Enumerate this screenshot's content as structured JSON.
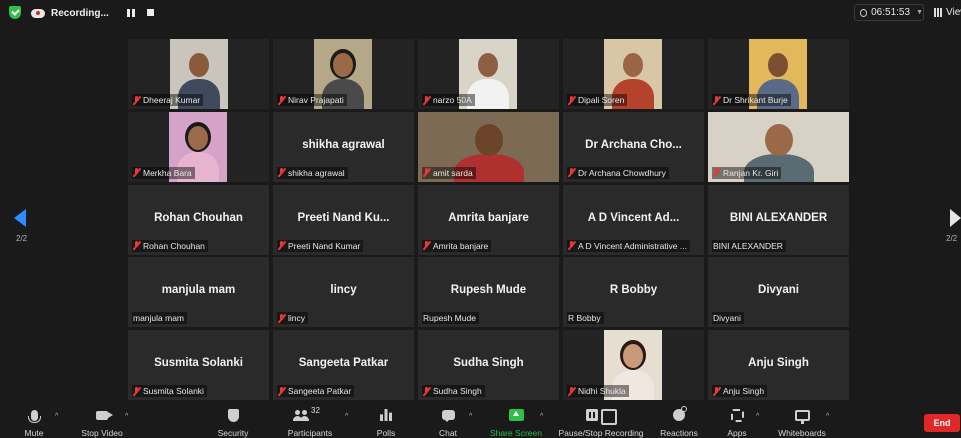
{
  "topbar": {
    "recording_label": "Recording...",
    "timer": "06:51:53",
    "view_label": "View"
  },
  "nav": {
    "page_left": "2/2",
    "page_right": "2/2"
  },
  "tiles": [
    {
      "label": "Dheeraj Kumar",
      "display": "",
      "muted": true
    },
    {
      "label": "Nirav Prajapati",
      "display": "",
      "muted": true
    },
    {
      "label": "narzo 50A",
      "display": "",
      "muted": true
    },
    {
      "label": "Dipali Soren",
      "display": "",
      "muted": true
    },
    {
      "label": "Dr Shrikant Burje",
      "display": "",
      "muted": true
    },
    {
      "label": "Merkha Bara",
      "display": "",
      "muted": true
    },
    {
      "label": "shikha agrawal",
      "display": "shikha agrawal",
      "muted": true
    },
    {
      "label": "amit sarda",
      "display": "",
      "muted": true
    },
    {
      "label": "Dr Archana Chowdhury",
      "display": "Dr Archana Cho...",
      "muted": true
    },
    {
      "label": "Ranjan Kr. Giri",
      "display": "",
      "muted": true
    },
    {
      "label": "Rohan Chouhan",
      "display": "Rohan Chouhan",
      "muted": true
    },
    {
      "label": "Preeti Nand Kumar",
      "display": "Preeti Nand Ku...",
      "muted": true
    },
    {
      "label": "Amrita banjare",
      "display": "Amrita banjare",
      "muted": true
    },
    {
      "label": "A D Vincent Administrative ...",
      "display": "A D Vincent Ad...",
      "muted": true
    },
    {
      "label": "BINI ALEXANDER",
      "display": "BINI ALEXANDER",
      "muted": false
    },
    {
      "label": "manjula mam",
      "display": "manjula mam",
      "muted": false
    },
    {
      "label": "lincy",
      "display": "lincy",
      "muted": true
    },
    {
      "label": "Rupesh Mude",
      "display": "Rupesh Mude",
      "muted": false
    },
    {
      "label": "R Bobby",
      "display": "R Bobby",
      "muted": false
    },
    {
      "label": "Divyani",
      "display": "Divyani",
      "muted": false
    },
    {
      "label": "Susmita Solanki",
      "display": "Susmita Solanki",
      "muted": true
    },
    {
      "label": "Sangeeta Patkar",
      "display": "Sangeeta Patkar",
      "muted": true
    },
    {
      "label": "Sudha Singh",
      "display": "Sudha Singh",
      "muted": true
    },
    {
      "label": "Nidhi Shukla",
      "display": "",
      "muted": true
    },
    {
      "label": "Anju Singh",
      "display": "Anju Singh",
      "muted": true
    }
  ],
  "toolbar": {
    "mute": "Mute",
    "stop_video": "Stop Video",
    "security": "Security",
    "participants": "Participants",
    "participants_count": "32",
    "polls": "Polls",
    "chat": "Chat",
    "share_screen": "Share Screen",
    "pause_stop_recording": "Pause/Stop Recording",
    "reactions": "Reactions",
    "apps": "Apps",
    "whiteboards": "Whiteboards",
    "end": "End"
  },
  "colors": {
    "accent_blue": "#2d8cff",
    "share_green": "#2fbf4a",
    "end_red": "#e02828",
    "muted_red": "#e53935"
  }
}
